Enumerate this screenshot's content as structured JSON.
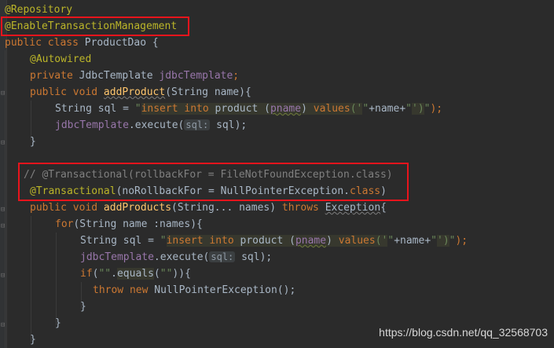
{
  "code": {
    "l1_ann": "@Repository",
    "l2_ann": "@EnableTransactionManagement",
    "l3_public": "public class ",
    "l3_name": "ProductDao {",
    "l4_ann": "@Autowired",
    "l5_private": "private ",
    "l5_type": "JdbcTemplate ",
    "l5_field": "jdbcTemplate",
    "l5_semi": ";",
    "l6_kw": "public void ",
    "l6_method": "addProduct",
    "l6_rest": "(String name){",
    "l7_a": "String sql = ",
    "l7_q1": "\"",
    "l7_ins": "insert into",
    "l7_product": " product ",
    "l7_p": "(",
    "l7_pname": "pname",
    "l7_p2": ") ",
    "l7_values": "values",
    "l7_v1": "('",
    "l7_q2": "\"",
    "l7_plus": "+name+",
    "l7_q3": "\"",
    "l7_v2": "')",
    "l7_q4": "\"",
    "l7_end": ");",
    "l8_field": "jdbcTemplate",
    "l8_dot": ".execute(",
    "l8_hint": "sql:",
    "l8_arg": " sql);",
    "l9": "}",
    "l10": "// @Transactional(rollbackFor = FileNotFoundException.class)",
    "l11_ann": "@Transactional",
    "l11_rest": "(noRollbackFor = NullPointerException.",
    "l11_class": "class",
    "l11_end": ")",
    "l12_kw": "public void ",
    "l12_method": "addProducts",
    "l12_mid": "(String... names) ",
    "l12_throws": "throws ",
    "l12_exc": "Exception",
    "l12_end": "{",
    "l13_for": "for",
    "l13_rest": "(String name :names){",
    "l14_a": "String sql = ",
    "l15_field": "jdbcTemplate",
    "l15_dot": ".execute(",
    "l15_hint": "sql:",
    "l15_arg": " sql);",
    "l16_if": "if",
    "l16_a": "(",
    "l16_str1": "\"\"",
    "l16_dot": ".",
    "l16_eq": "equals",
    "l16_b": "(",
    "l16_str2": "\"\"",
    "l16_c": ")){",
    "l17_throw": "throw new ",
    "l17_rest": "NullPointerException();",
    "l18": "}",
    "l19": "}",
    "l20": "}"
  },
  "watermark": "https://blog.csdn.net/qq_32568703",
  "colors": {
    "background": "#2b2b2b",
    "annotation": "#bbb529",
    "keyword": "#cc7832",
    "string": "#6a8759",
    "field": "#9876aa",
    "method": "#ffc66d",
    "highlight_box": "#e8141c"
  }
}
